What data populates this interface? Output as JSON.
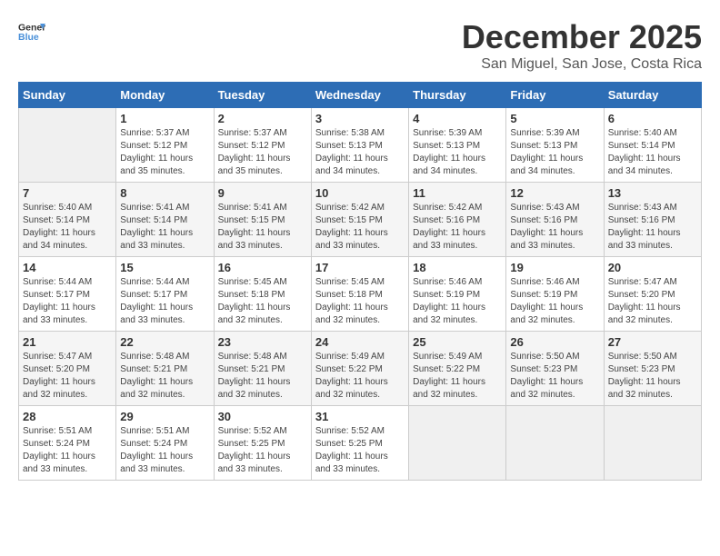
{
  "logo": {
    "text_general": "General",
    "text_blue": "Blue"
  },
  "title": "December 2025",
  "location": "San Miguel, San Jose, Costa Rica",
  "days_of_week": [
    "Sunday",
    "Monday",
    "Tuesday",
    "Wednesday",
    "Thursday",
    "Friday",
    "Saturday"
  ],
  "weeks": [
    [
      {
        "day": "",
        "empty": true
      },
      {
        "day": "1",
        "sunrise": "Sunrise: 5:37 AM",
        "sunset": "Sunset: 5:12 PM",
        "daylight": "Daylight: 11 hours and 35 minutes."
      },
      {
        "day": "2",
        "sunrise": "Sunrise: 5:37 AM",
        "sunset": "Sunset: 5:12 PM",
        "daylight": "Daylight: 11 hours and 35 minutes."
      },
      {
        "day": "3",
        "sunrise": "Sunrise: 5:38 AM",
        "sunset": "Sunset: 5:13 PM",
        "daylight": "Daylight: 11 hours and 34 minutes."
      },
      {
        "day": "4",
        "sunrise": "Sunrise: 5:39 AM",
        "sunset": "Sunset: 5:13 PM",
        "daylight": "Daylight: 11 hours and 34 minutes."
      },
      {
        "day": "5",
        "sunrise": "Sunrise: 5:39 AM",
        "sunset": "Sunset: 5:13 PM",
        "daylight": "Daylight: 11 hours and 34 minutes."
      },
      {
        "day": "6",
        "sunrise": "Sunrise: 5:40 AM",
        "sunset": "Sunset: 5:14 PM",
        "daylight": "Daylight: 11 hours and 34 minutes."
      }
    ],
    [
      {
        "day": "7",
        "sunrise": "Sunrise: 5:40 AM",
        "sunset": "Sunset: 5:14 PM",
        "daylight": "Daylight: 11 hours and 34 minutes."
      },
      {
        "day": "8",
        "sunrise": "Sunrise: 5:41 AM",
        "sunset": "Sunset: 5:14 PM",
        "daylight": "Daylight: 11 hours and 33 minutes."
      },
      {
        "day": "9",
        "sunrise": "Sunrise: 5:41 AM",
        "sunset": "Sunset: 5:15 PM",
        "daylight": "Daylight: 11 hours and 33 minutes."
      },
      {
        "day": "10",
        "sunrise": "Sunrise: 5:42 AM",
        "sunset": "Sunset: 5:15 PM",
        "daylight": "Daylight: 11 hours and 33 minutes."
      },
      {
        "day": "11",
        "sunrise": "Sunrise: 5:42 AM",
        "sunset": "Sunset: 5:16 PM",
        "daylight": "Daylight: 11 hours and 33 minutes."
      },
      {
        "day": "12",
        "sunrise": "Sunrise: 5:43 AM",
        "sunset": "Sunset: 5:16 PM",
        "daylight": "Daylight: 11 hours and 33 minutes."
      },
      {
        "day": "13",
        "sunrise": "Sunrise: 5:43 AM",
        "sunset": "Sunset: 5:16 PM",
        "daylight": "Daylight: 11 hours and 33 minutes."
      }
    ],
    [
      {
        "day": "14",
        "sunrise": "Sunrise: 5:44 AM",
        "sunset": "Sunset: 5:17 PM",
        "daylight": "Daylight: 11 hours and 33 minutes."
      },
      {
        "day": "15",
        "sunrise": "Sunrise: 5:44 AM",
        "sunset": "Sunset: 5:17 PM",
        "daylight": "Daylight: 11 hours and 33 minutes."
      },
      {
        "day": "16",
        "sunrise": "Sunrise: 5:45 AM",
        "sunset": "Sunset: 5:18 PM",
        "daylight": "Daylight: 11 hours and 32 minutes."
      },
      {
        "day": "17",
        "sunrise": "Sunrise: 5:45 AM",
        "sunset": "Sunset: 5:18 PM",
        "daylight": "Daylight: 11 hours and 32 minutes."
      },
      {
        "day": "18",
        "sunrise": "Sunrise: 5:46 AM",
        "sunset": "Sunset: 5:19 PM",
        "daylight": "Daylight: 11 hours and 32 minutes."
      },
      {
        "day": "19",
        "sunrise": "Sunrise: 5:46 AM",
        "sunset": "Sunset: 5:19 PM",
        "daylight": "Daylight: 11 hours and 32 minutes."
      },
      {
        "day": "20",
        "sunrise": "Sunrise: 5:47 AM",
        "sunset": "Sunset: 5:20 PM",
        "daylight": "Daylight: 11 hours and 32 minutes."
      }
    ],
    [
      {
        "day": "21",
        "sunrise": "Sunrise: 5:47 AM",
        "sunset": "Sunset: 5:20 PM",
        "daylight": "Daylight: 11 hours and 32 minutes."
      },
      {
        "day": "22",
        "sunrise": "Sunrise: 5:48 AM",
        "sunset": "Sunset: 5:21 PM",
        "daylight": "Daylight: 11 hours and 32 minutes."
      },
      {
        "day": "23",
        "sunrise": "Sunrise: 5:48 AM",
        "sunset": "Sunset: 5:21 PM",
        "daylight": "Daylight: 11 hours and 32 minutes."
      },
      {
        "day": "24",
        "sunrise": "Sunrise: 5:49 AM",
        "sunset": "Sunset: 5:22 PM",
        "daylight": "Daylight: 11 hours and 32 minutes."
      },
      {
        "day": "25",
        "sunrise": "Sunrise: 5:49 AM",
        "sunset": "Sunset: 5:22 PM",
        "daylight": "Daylight: 11 hours and 32 minutes."
      },
      {
        "day": "26",
        "sunrise": "Sunrise: 5:50 AM",
        "sunset": "Sunset: 5:23 PM",
        "daylight": "Daylight: 11 hours and 32 minutes."
      },
      {
        "day": "27",
        "sunrise": "Sunrise: 5:50 AM",
        "sunset": "Sunset: 5:23 PM",
        "daylight": "Daylight: 11 hours and 32 minutes."
      }
    ],
    [
      {
        "day": "28",
        "sunrise": "Sunrise: 5:51 AM",
        "sunset": "Sunset: 5:24 PM",
        "daylight": "Daylight: 11 hours and 33 minutes."
      },
      {
        "day": "29",
        "sunrise": "Sunrise: 5:51 AM",
        "sunset": "Sunset: 5:24 PM",
        "daylight": "Daylight: 11 hours and 33 minutes."
      },
      {
        "day": "30",
        "sunrise": "Sunrise: 5:52 AM",
        "sunset": "Sunset: 5:25 PM",
        "daylight": "Daylight: 11 hours and 33 minutes."
      },
      {
        "day": "31",
        "sunrise": "Sunrise: 5:52 AM",
        "sunset": "Sunset: 5:25 PM",
        "daylight": "Daylight: 11 hours and 33 minutes."
      },
      {
        "day": "",
        "empty": true
      },
      {
        "day": "",
        "empty": true
      },
      {
        "day": "",
        "empty": true
      }
    ]
  ]
}
